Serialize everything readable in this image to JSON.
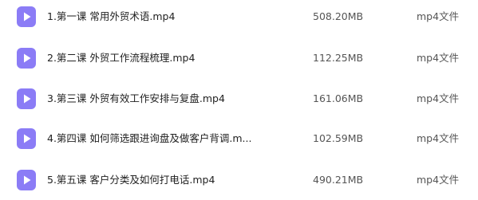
{
  "icon_name": "video-file-icon",
  "icon_color": "#8b7cf6",
  "files": [
    {
      "name": "1.第一课 常用外贸术语.mp4",
      "size": "508.20MB",
      "type": "mp4文件"
    },
    {
      "name": "2.第二课 外贸工作流程梳理.mp4",
      "size": "112.25MB",
      "type": "mp4文件"
    },
    {
      "name": "3.第三课 外贸有效工作安排与复盘.mp4",
      "size": "161.06MB",
      "type": "mp4文件"
    },
    {
      "name": "4.第四课 如何筛选跟进询盘及做客户背调.m...",
      "size": "102.59MB",
      "type": "mp4文件"
    },
    {
      "name": "5.第五课 客户分类及如何打电话.mp4",
      "size": "490.21MB",
      "type": "mp4文件"
    }
  ]
}
